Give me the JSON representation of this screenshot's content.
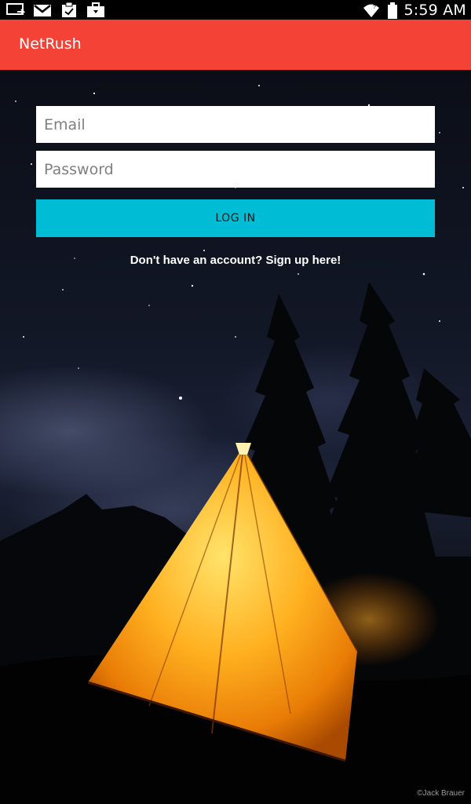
{
  "status_bar": {
    "time": "5:59 AM",
    "left_icons": [
      "screen-cast-icon",
      "gmail-icon",
      "clipboard-icon",
      "briefcase-icon"
    ],
    "right_icons": [
      "wifi-icon",
      "battery-icon"
    ]
  },
  "app_bar": {
    "title": "NetRush",
    "color": "#f44336"
  },
  "login_form": {
    "email_placeholder": "Email",
    "password_placeholder": "Password",
    "login_label": "LOG IN",
    "login_color": "#00bcd4",
    "signup_text": "Don't have an account? Sign up here!"
  },
  "background": {
    "credit": "©Jack Brauer"
  }
}
